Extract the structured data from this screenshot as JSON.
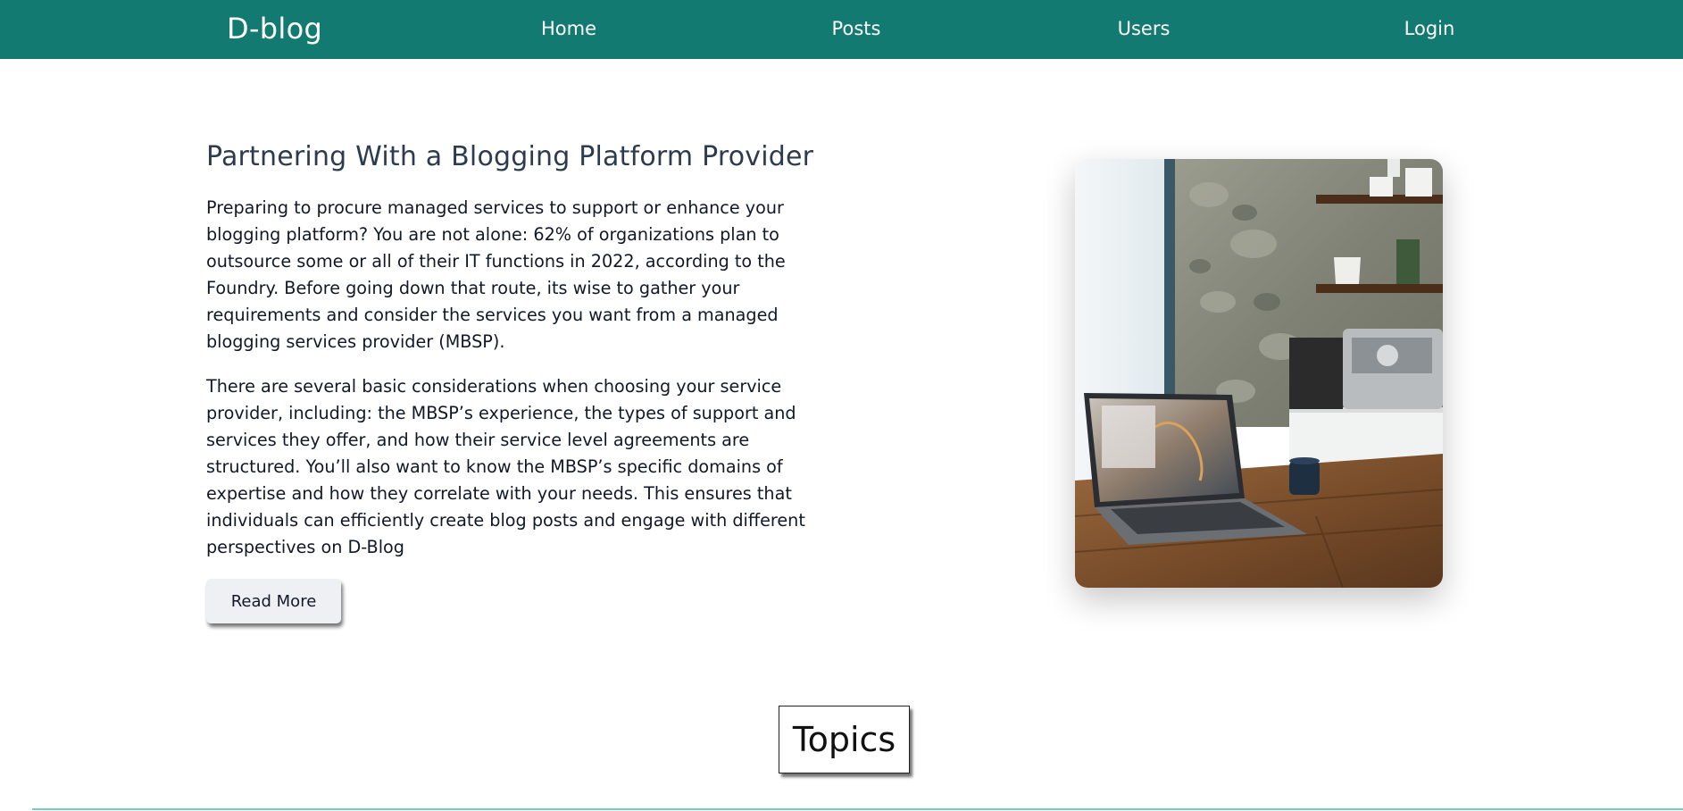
{
  "navbar": {
    "brand": "D-blog",
    "links": [
      {
        "label": "Home"
      },
      {
        "label": "Posts"
      },
      {
        "label": "Users"
      },
      {
        "label": "Login"
      }
    ],
    "color": "#127a70"
  },
  "hero": {
    "title": "Partnering With a Blogging Platform Provider",
    "paragraphs": [
      "Preparing to procure managed services to support or enhance your blogging platform? You are not alone: 62% of organizations plan to outsource some or all of their IT functions in 2022, according to the Foundry. Before going down that route, its wise to gather your requirements and consider the services you want from a managed blogging services provider (MBSP).",
      "There are several basic considerations when choosing your service provider, including: the MBSP’s experience, the types of support and services they offer, and how their service level agreements are structured. You’ll also want to know the MBSP’s specific domains of expertise and how they correlate with your needs. This ensures that individuals can efficiently create blog posts and engage with different perspectives on D-Blog"
    ],
    "read_more_label": "Read More",
    "image_alt": "laptop-on-wooden-table-photo"
  },
  "topics": {
    "title": "Topics"
  }
}
